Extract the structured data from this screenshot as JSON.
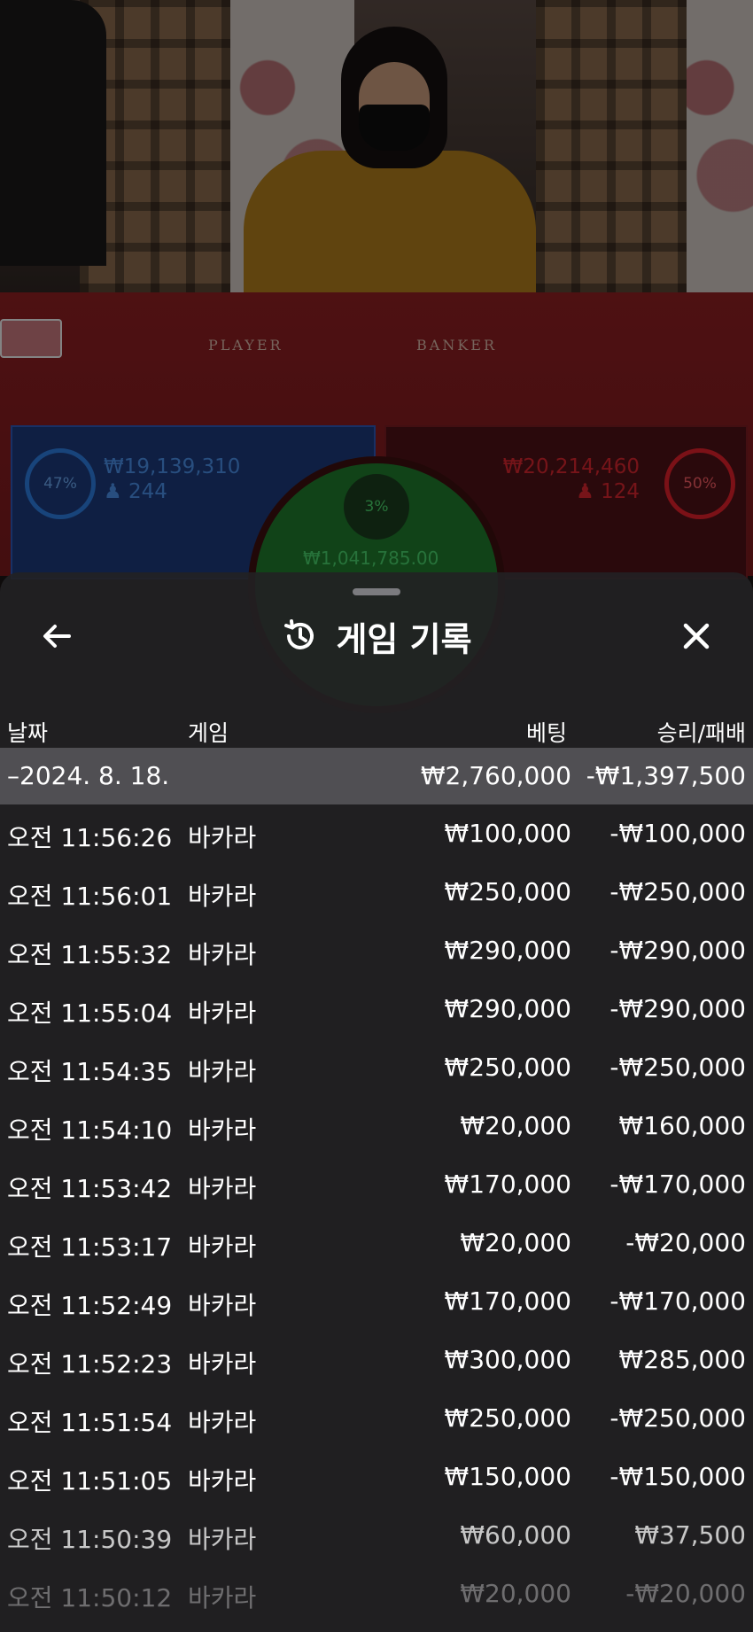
{
  "table": {
    "player_label": "PLAYER",
    "banker_label": "BANKER",
    "player": {
      "percent": "47%",
      "amount": "₩19,139,310",
      "count": "244",
      "color": "#2d7de0"
    },
    "banker": {
      "percent": "50%",
      "amount": "₩20,214,460",
      "count": "124",
      "color": "#e0202a"
    },
    "tie": {
      "percent": "3%",
      "amount": "₩1,041,785.00",
      "color": "#49d26a"
    }
  },
  "sheet": {
    "back_icon": "arrow-left-icon",
    "history_icon": "history-icon",
    "close_icon": "close-icon",
    "title": "게임 기록",
    "columns": {
      "date": "날짜",
      "game": "게임",
      "bet": "베팅",
      "result": "승리/패배"
    },
    "summary": {
      "date": "–2024. 8. 18.",
      "bet": "₩2,760,000",
      "result": "-₩1,397,500"
    },
    "rows": [
      {
        "time": "오전 11:56:26",
        "game": "바카라",
        "bet": "₩100,000",
        "result": "-₩100,000"
      },
      {
        "time": "오전 11:56:01",
        "game": "바카라",
        "bet": "₩250,000",
        "result": "-₩250,000"
      },
      {
        "time": "오전 11:55:32",
        "game": "바카라",
        "bet": "₩290,000",
        "result": "-₩290,000"
      },
      {
        "time": "오전 11:55:04",
        "game": "바카라",
        "bet": "₩290,000",
        "result": "-₩290,000"
      },
      {
        "time": "오전 11:54:35",
        "game": "바카라",
        "bet": "₩250,000",
        "result": "-₩250,000"
      },
      {
        "time": "오전 11:54:10",
        "game": "바카라",
        "bet": "₩20,000",
        "result": "₩160,000"
      },
      {
        "time": "오전 11:53:42",
        "game": "바카라",
        "bet": "₩170,000",
        "result": "-₩170,000"
      },
      {
        "time": "오전 11:53:17",
        "game": "바카라",
        "bet": "₩20,000",
        "result": "-₩20,000"
      },
      {
        "time": "오전 11:52:49",
        "game": "바카라",
        "bet": "₩170,000",
        "result": "-₩170,000"
      },
      {
        "time": "오전 11:52:23",
        "game": "바카라",
        "bet": "₩300,000",
        "result": "₩285,000"
      },
      {
        "time": "오전 11:51:54",
        "game": "바카라",
        "bet": "₩250,000",
        "result": "-₩250,000"
      },
      {
        "time": "오전 11:51:05",
        "game": "바카라",
        "bet": "₩150,000",
        "result": "-₩150,000"
      },
      {
        "time": "오전 11:50:39",
        "game": "바카라",
        "bet": "₩60,000",
        "result": "₩37,500"
      },
      {
        "time": "오전 11:50:12",
        "game": "바카라",
        "bet": "₩20,000",
        "result": "-₩20,000"
      }
    ]
  }
}
